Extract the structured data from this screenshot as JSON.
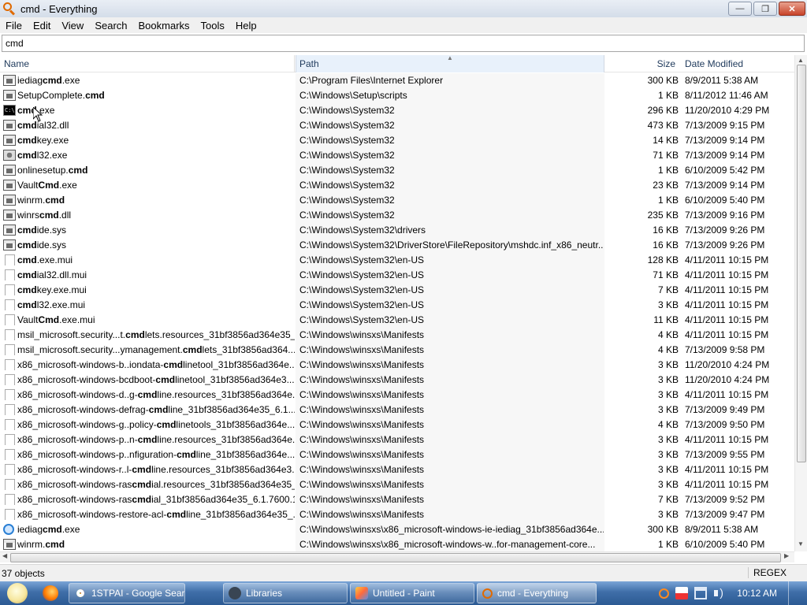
{
  "window": {
    "title": "cmd - Everything",
    "buttons": {
      "minimize": "—",
      "maximize": "❐",
      "close": "✕"
    }
  },
  "menu": [
    "File",
    "Edit",
    "View",
    "Search",
    "Bookmarks",
    "Tools",
    "Help"
  ],
  "search": {
    "value": "cmd"
  },
  "columns": {
    "name": "Name",
    "path": "Path",
    "size": "Size",
    "date": "Date Modified"
  },
  "rows": [
    {
      "icon": "exe-icon",
      "pre": "iediag",
      "hl": "cmd",
      "post": ".exe",
      "path": "C:\\Program Files\\Internet Explorer",
      "size": "300 KB",
      "date": "8/9/2011 5:38 AM"
    },
    {
      "icon": "exe-icon",
      "pre": "SetupComplete.",
      "hl": "cmd",
      "post": "",
      "path": "C:\\Windows\\Setup\\scripts",
      "size": "1 KB",
      "date": "8/11/2012 11:46 AM"
    },
    {
      "icon": "cmd-icon",
      "pre": "",
      "hl": "cmd",
      "post": ".exe",
      "path": "C:\\Windows\\System32",
      "size": "296 KB",
      "date": "11/20/2010 4:29 PM"
    },
    {
      "icon": "exe-icon",
      "pre": "",
      "hl": "cmd",
      "post": "ial32.dll",
      "path": "C:\\Windows\\System32",
      "size": "473 KB",
      "date": "7/13/2009 9:15 PM"
    },
    {
      "icon": "exe-icon",
      "pre": "",
      "hl": "cmd",
      "post": "key.exe",
      "path": "C:\\Windows\\System32",
      "size": "14 KB",
      "date": "7/13/2009 9:14 PM"
    },
    {
      "icon": "gear-icon",
      "pre": "",
      "hl": "cmd",
      "post": "l32.exe",
      "path": "C:\\Windows\\System32",
      "size": "71 KB",
      "date": "7/13/2009 9:14 PM"
    },
    {
      "icon": "exe-icon",
      "pre": "onlinesetup.",
      "hl": "cmd",
      "post": "",
      "path": "C:\\Windows\\System32",
      "size": "1 KB",
      "date": "6/10/2009 5:42 PM"
    },
    {
      "icon": "exe-icon",
      "pre": "Vault",
      "hl": "Cmd",
      "post": ".exe",
      "path": "C:\\Windows\\System32",
      "size": "23 KB",
      "date": "7/13/2009 9:14 PM"
    },
    {
      "icon": "exe-icon",
      "pre": "winrm.",
      "hl": "cmd",
      "post": "",
      "path": "C:\\Windows\\System32",
      "size": "1 KB",
      "date": "6/10/2009 5:40 PM"
    },
    {
      "icon": "exe-icon",
      "pre": "winrs",
      "hl": "cmd",
      "post": ".dll",
      "path": "C:\\Windows\\System32",
      "size": "235 KB",
      "date": "7/13/2009 9:16 PM"
    },
    {
      "icon": "exe-icon",
      "pre": "",
      "hl": "cmd",
      "post": "ide.sys",
      "path": "C:\\Windows\\System32\\drivers",
      "size": "16 KB",
      "date": "7/13/2009 9:26 PM"
    },
    {
      "icon": "exe-icon",
      "pre": "",
      "hl": "cmd",
      "post": "ide.sys",
      "path": "C:\\Windows\\System32\\DriverStore\\FileRepository\\mshdc.inf_x86_neutr...",
      "size": "16 KB",
      "date": "7/13/2009 9:26 PM"
    },
    {
      "icon": "doc-icon",
      "pre": "",
      "hl": "cmd",
      "post": ".exe.mui",
      "path": "C:\\Windows\\System32\\en-US",
      "size": "128 KB",
      "date": "4/11/2011 10:15 PM"
    },
    {
      "icon": "doc-icon",
      "pre": "",
      "hl": "cmd",
      "post": "ial32.dll.mui",
      "path": "C:\\Windows\\System32\\en-US",
      "size": "71 KB",
      "date": "4/11/2011 10:15 PM"
    },
    {
      "icon": "doc-icon",
      "pre": "",
      "hl": "cmd",
      "post": "key.exe.mui",
      "path": "C:\\Windows\\System32\\en-US",
      "size": "7 KB",
      "date": "4/11/2011 10:15 PM"
    },
    {
      "icon": "doc-icon",
      "pre": "",
      "hl": "cmd",
      "post": "l32.exe.mui",
      "path": "C:\\Windows\\System32\\en-US",
      "size": "3 KB",
      "date": "4/11/2011 10:15 PM"
    },
    {
      "icon": "doc-icon",
      "pre": "Vault",
      "hl": "Cmd",
      "post": ".exe.mui",
      "path": "C:\\Windows\\System32\\en-US",
      "size": "11 KB",
      "date": "4/11/2011 10:15 PM"
    },
    {
      "icon": "doc-icon",
      "pre": "msil_microsoft.security...t.",
      "hl": "cmd",
      "post": "lets.resources_31bf3856ad364e35_...",
      "path": "C:\\Windows\\winsxs\\Manifests",
      "size": "4 KB",
      "date": "4/11/2011 10:15 PM"
    },
    {
      "icon": "doc-icon",
      "pre": "msil_microsoft.security...ymanagement.",
      "hl": "cmd",
      "post": "lets_31bf3856ad364...",
      "path": "C:\\Windows\\winsxs\\Manifests",
      "size": "4 KB",
      "date": "7/13/2009 9:58 PM"
    },
    {
      "icon": "doc-icon",
      "pre": "x86_microsoft-windows-b..iondata-",
      "hl": "cmd",
      "post": "linetool_31bf3856ad364e...",
      "path": "C:\\Windows\\winsxs\\Manifests",
      "size": "3 KB",
      "date": "11/20/2010 4:24 PM"
    },
    {
      "icon": "doc-icon",
      "pre": "x86_microsoft-windows-bcdboot-",
      "hl": "cmd",
      "post": "linetool_31bf3856ad364e3...",
      "path": "C:\\Windows\\winsxs\\Manifests",
      "size": "3 KB",
      "date": "11/20/2010 4:24 PM"
    },
    {
      "icon": "doc-icon",
      "pre": "x86_microsoft-windows-d..g-",
      "hl": "cmd",
      "post": "line.resources_31bf3856ad364e...",
      "path": "C:\\Windows\\winsxs\\Manifests",
      "size": "3 KB",
      "date": "4/11/2011 10:15 PM"
    },
    {
      "icon": "doc-icon",
      "pre": "x86_microsoft-windows-defrag-",
      "hl": "cmd",
      "post": "line_31bf3856ad364e35_6.1....",
      "path": "C:\\Windows\\winsxs\\Manifests",
      "size": "3 KB",
      "date": "7/13/2009 9:49 PM"
    },
    {
      "icon": "doc-icon",
      "pre": "x86_microsoft-windows-g..policy-",
      "hl": "cmd",
      "post": "linetools_31bf3856ad364e...",
      "path": "C:\\Windows\\winsxs\\Manifests",
      "size": "4 KB",
      "date": "7/13/2009 9:50 PM"
    },
    {
      "icon": "doc-icon",
      "pre": "x86_microsoft-windows-p..n-",
      "hl": "cmd",
      "post": "line.resources_31bf3856ad364e...",
      "path": "C:\\Windows\\winsxs\\Manifests",
      "size": "3 KB",
      "date": "4/11/2011 10:15 PM"
    },
    {
      "icon": "doc-icon",
      "pre": "x86_microsoft-windows-p..nfiguration-",
      "hl": "cmd",
      "post": "line_31bf3856ad364e...",
      "path": "C:\\Windows\\winsxs\\Manifests",
      "size": "3 KB",
      "date": "7/13/2009 9:55 PM"
    },
    {
      "icon": "doc-icon",
      "pre": "x86_microsoft-windows-r..l-",
      "hl": "cmd",
      "post": "line.resources_31bf3856ad364e3...",
      "path": "C:\\Windows\\winsxs\\Manifests",
      "size": "3 KB",
      "date": "4/11/2011 10:15 PM"
    },
    {
      "icon": "doc-icon",
      "pre": "x86_microsoft-windows-ras",
      "hl": "cmd",
      "post": "ial.resources_31bf3856ad364e35_...",
      "path": "C:\\Windows\\winsxs\\Manifests",
      "size": "3 KB",
      "date": "4/11/2011 10:15 PM"
    },
    {
      "icon": "doc-icon",
      "pre": "x86_microsoft-windows-ras",
      "hl": "cmd",
      "post": "ial_31bf3856ad364e35_6.1.7600.1...",
      "path": "C:\\Windows\\winsxs\\Manifests",
      "size": "7 KB",
      "date": "7/13/2009 9:52 PM"
    },
    {
      "icon": "doc-icon",
      "pre": "x86_microsoft-windows-restore-acl-",
      "hl": "cmd",
      "post": "line_31bf3856ad364e35_...",
      "path": "C:\\Windows\\winsxs\\Manifests",
      "size": "3 KB",
      "date": "7/13/2009 9:47 PM"
    },
    {
      "icon": "ie-icon",
      "pre": "iediag",
      "hl": "cmd",
      "post": ".exe",
      "path": "C:\\Windows\\winsxs\\x86_microsoft-windows-ie-iediag_31bf3856ad364e...",
      "size": "300 KB",
      "date": "8/9/2011 5:38 AM"
    },
    {
      "icon": "exe-icon",
      "pre": "winrm.",
      "hl": "cmd",
      "post": "",
      "path": "C:\\Windows\\winsxs\\x86_microsoft-windows-w..for-management-core...",
      "size": "1 KB",
      "date": "6/10/2009 5:40 PM"
    }
  ],
  "status": {
    "count": "37 objects",
    "mode": "REGEX"
  },
  "taskbar": {
    "tasks": [
      {
        "label": "1STPAI - Google Sear...",
        "icon": "chrome-icon"
      },
      {
        "label": "Libraries",
        "icon": "libraries-icon"
      },
      {
        "label": "Untitled - Paint",
        "icon": "paint-icon"
      },
      {
        "label": "cmd - Everything",
        "icon": "everything-icon"
      }
    ],
    "clock": "10:12 AM"
  }
}
